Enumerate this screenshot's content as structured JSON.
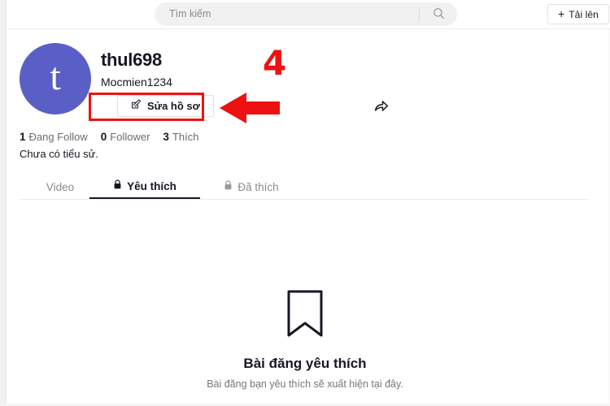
{
  "header": {
    "search": {
      "placeholder": "Tìm kiếm",
      "value": "",
      "icon": "search-icon"
    },
    "upload": {
      "label": "Tải lên",
      "plus": "+",
      "icon": "plus-icon"
    }
  },
  "profile": {
    "avatar_letter": "t",
    "avatar_color": "#5a5fc6",
    "username": "thul698",
    "display_name": "Mocmien1234",
    "edit_button": {
      "label": "Sửa hồ sơ",
      "icon": "edit-pencil-icon"
    },
    "share_icon": "share-arrow-icon",
    "stats": [
      {
        "count": "1",
        "label": "Đang Follow"
      },
      {
        "count": "0",
        "label": "Follower"
      },
      {
        "count": "3",
        "label": "Thích"
      }
    ],
    "bio": "Chưa có tiểu sử."
  },
  "tabs": [
    {
      "label": "Video",
      "active": false,
      "locked": false
    },
    {
      "label": "Yêu thích",
      "active": true,
      "locked": true,
      "icon": "lock-icon"
    },
    {
      "label": "Đã thích",
      "active": false,
      "locked": true,
      "icon": "lock-icon"
    }
  ],
  "empty_state": {
    "icon": "bookmark-icon",
    "title": "Bài đăng yêu thích",
    "subtitle": "Bài đăng bạn yêu thích sẽ xuất hiện tại đây."
  },
  "annotations": {
    "step_number": "4",
    "color": "#ee1111",
    "arrow": "left-arrow",
    "highlight": "edit-profile-button"
  }
}
